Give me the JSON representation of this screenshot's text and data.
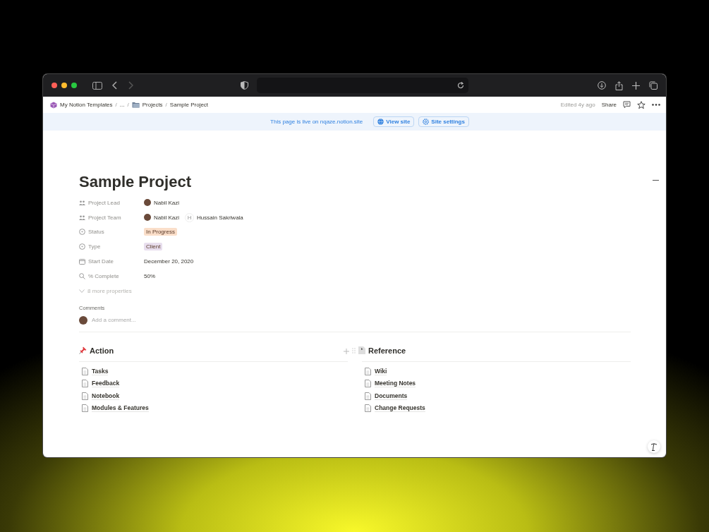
{
  "breadcrumb": [
    {
      "label": "My Notion Templates",
      "separator": "/"
    },
    {
      "label": "...",
      "separator": "/"
    },
    {
      "label": "Projects",
      "separator": "/"
    },
    {
      "label": "Sample Project"
    }
  ],
  "top_bar": {
    "edited": "Edited 4y ago",
    "share": "Share"
  },
  "banner": {
    "text": "This page is live on nqaze.notion.site",
    "buttons": [
      {
        "label": "View site"
      },
      {
        "label": "Site settings"
      }
    ]
  },
  "title": "Sample Project",
  "properties": [
    {
      "label": "Project Lead",
      "kind": "people",
      "people": [
        {
          "name": "Nabil Kazi",
          "kind": "photo"
        }
      ]
    },
    {
      "label": "Project Team",
      "kind": "people",
      "people": [
        {
          "name": "Nabil Kazi",
          "kind": "photo"
        },
        {
          "name": "Hussain Sakriwala",
          "kind": "initial",
          "initial": "H"
        }
      ]
    },
    {
      "label": "Status",
      "kind": "tag",
      "value": "In Progress",
      "color": "#fadec9"
    },
    {
      "label": "Type",
      "kind": "tag",
      "value": "Client",
      "color": "#e8deee"
    },
    {
      "label": "Start Date",
      "kind": "date",
      "value": "December 20, 2020"
    },
    {
      "label": "% Complete",
      "kind": "number",
      "value": "50%"
    }
  ],
  "more_properties": "8 more properties",
  "comments": {
    "heading": "Comments",
    "placeholder": "Add a comment..."
  },
  "columns": [
    {
      "heading": "Action",
      "pages": [
        "Tasks",
        "Feedback",
        "Notebook",
        "Modules & Features"
      ]
    },
    {
      "heading": "Reference",
      "pages": [
        "Wiki",
        "Meeting Notes",
        "Documents",
        "Change Requests"
      ]
    }
  ]
}
